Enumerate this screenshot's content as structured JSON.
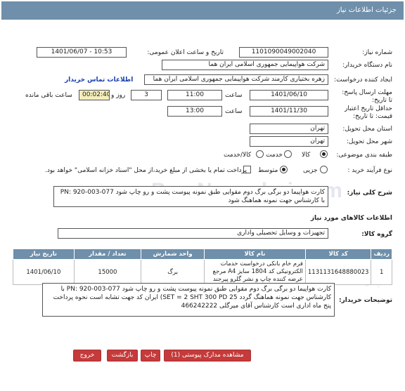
{
  "title": "جزئیات اطلاعات نیاز",
  "fields": {
    "need_number_label": "شماره نیاز:",
    "need_number": "1101090049002040",
    "announce_label": "تاریخ و ساعت اعلان عمومی:",
    "announce_value": "1401/06/07 - 10:53",
    "buyer_org_label": "نام دستگاه خریدار:",
    "buyer_org": "شرکت هواپیمایی جمهوری اسلامی ایران هما",
    "creator_label": "ایجاد کننده درخواست:",
    "creator": "زهره بختیاری کارمند شرکت هواپیمایی جمهوری اسلامی ایران هما",
    "contact_link": "اطلاعات تماس خریدار",
    "deadline_label": "مهلت ارسال پاسخ: تا تاریخ:",
    "deadline_date": "1401/06/10",
    "time_label": "ساعت",
    "deadline_time": "11:00",
    "days_value": "3",
    "days_label": "روز و",
    "remaining_value": "00:02:40",
    "remaining_label": "ساعت باقی مانده",
    "validity_label": "حداقل تاریخ اعتبار قیمت: تا تاریخ:",
    "validity_date": "1401/11/30",
    "validity_time_label": "ساعت",
    "validity_time": "13:00",
    "province_label": "استان محل تحویل:",
    "province": "تهران",
    "city_label": "شهر محل تحویل:",
    "city": "تهران",
    "category_label": "طبقه بندی موضوعی:",
    "cat_goods": "کالا",
    "cat_service": "خدمت",
    "cat_goods_service": "کالا/خدمت",
    "process_label": "نوع فرآیند خرید :",
    "proc_partial": "جزیی",
    "proc_medium": "متوسط",
    "payment_note": "پرداخت تمام یا بخشی از مبلغ خرید،از محل \"اسناد خزانه اسلامی\" خواهد بود."
  },
  "summary": {
    "label": "شرح کلی نیاز:",
    "text": "کارت هواپیما دو برگی برگ دوم مقوایی  طبق نمونه پیوست  پشت و رو چاپ شود PN: 920-003-077 با کارشناس جهت نمونه هماهنگ شود"
  },
  "goods_info_title": "اطلاعات کالاهای مورد نیاز",
  "goods_group": {
    "label": "گروه کالا:",
    "value": "تجهیزات و وسایل تحصیلی واداری"
  },
  "table": {
    "headers": [
      "ردیف",
      "کد کالا",
      "نام کالا",
      "واحد شمارش",
      "تعداد / مقدار",
      "تاریخ نیاز"
    ],
    "rows": [
      {
        "row": "1",
        "code": "1131131648880023",
        "name": "فرم خام بانکی درخواست خدمات الکترونیکی کد 1804 سایز A4 مرجع عرضه کننده چاپ و نشر گلرو پیرجند",
        "unit": "برگ",
        "qty": "15000",
        "date": "1401/06/10"
      }
    ]
  },
  "buyer_notes": {
    "label": "توضیحات خریدار:",
    "text": "کارت هواپیما دو برگی برگ دوم مقوایی  طبق نمونه پیوست  پشت و رو چاپ شود PN: 920-003-077 با کارشناس جهت نمونه هماهنگ گردد SET = 2 SHT  300  PD 25) ایران کد جهت تشابه است نحوه پرداخت پنج ماه اداری است کارشناس آقای میرگلی 466242222"
  },
  "buttons": {
    "attachments": "مشاهده مدارک پیوستی (1)",
    "print": "چاپ",
    "back": "بازگشت",
    "exit": "خروج"
  },
  "watermarks": [
    "ParsNamadari.com",
    "پایگاه اطلاع رسانی مناقصات",
    "ParsNamadari.com"
  ]
}
